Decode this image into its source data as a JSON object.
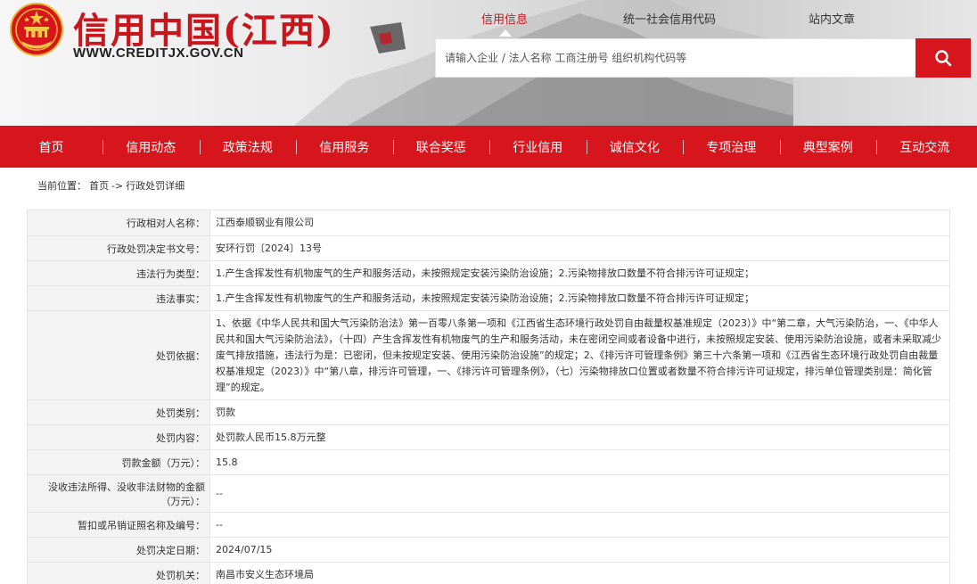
{
  "site": {
    "title": "信用中国(江西)",
    "url": "WWW.CREDITJX.GOV.CN"
  },
  "top_links": [
    {
      "label": "信用信息",
      "active": true
    },
    {
      "label": "统一社会信用代码",
      "active": false
    },
    {
      "label": "站内文章",
      "active": false
    }
  ],
  "search": {
    "placeholder": "请输入企业 / 法人名称 工商注册号 组织机构代码等"
  },
  "nav": [
    "首页",
    "信用动态",
    "政策法规",
    "信用服务",
    "联合奖惩",
    "行业信用",
    "诚信文化",
    "专项治理",
    "典型案例",
    "互动交流"
  ],
  "breadcrumb": {
    "prefix": "当前位置：",
    "home": "首页",
    "sep": "->",
    "current": "行政处罚详细"
  },
  "rows": [
    {
      "label": "行政相对人名称：",
      "value": "江西泰顺钢业有限公司"
    },
    {
      "label": "行政处罚决定书文号：",
      "value": "安环行罚〔2024〕13号"
    },
    {
      "label": "违法行为类型：",
      "value": "1.产生含挥发性有机物废气的生产和服务活动，未按照规定安装污染防治设施；2.污染物排放口数量不符合排污许可证规定；"
    },
    {
      "label": "违法事实：",
      "value": "1.产生含挥发性有机物废气的生产和服务活动，未按照规定安装污染防治设施；2.污染物排放口数量不符合排污许可证规定；"
    },
    {
      "label": "处罚依据：",
      "value": "1、依据《中华人民共和国大气污染防治法》第一百零八条第一项和《江西省生态环境行政处罚自由裁量权基准规定（2023）》中“第二章，大气污染防治，一、《中华人民共和国大气污染防治法》，（十四）产生含挥发性有机物废气的生产和服务活动，未在密闭空间或者设备中进行，未按照规定安装、使用污染防治设施，或者未采取减少废气排放措施，违法行为是：已密闭，但未按规定安装、使用污染防治设施”的规定；2、《排污许可管理条例》第三十六条第一项和《江西省生态环境行政处罚自由裁量权基准规定（2023）》中“第八章，排污许可管理，一、《排污许可管理条例》，（七）污染物排放口位置或者数量不符合排污许可证规定，排污单位管理类别是：简化管理”的规定。"
    },
    {
      "label": "处罚类别：",
      "value": "罚款"
    },
    {
      "label": "处罚内容：",
      "value": "处罚款人民币15.8万元整"
    },
    {
      "label": "罚款金额（万元）：",
      "value": "15.8"
    },
    {
      "label": "没收违法所得、没收非法财物的金额（万元）：",
      "value": "--"
    },
    {
      "label": "暂扣或吊销证照名称及编号：",
      "value": "--"
    },
    {
      "label": "处罚决定日期：",
      "value": "2024/07/15"
    },
    {
      "label": "处罚机关：",
      "value": "南昌市安义生态环境局"
    }
  ],
  "colors": {
    "brand_red": "#d7151c",
    "title_red": "#c8161d"
  },
  "icons": {
    "emblem": "national-emblem-icon",
    "search": "search-icon"
  }
}
